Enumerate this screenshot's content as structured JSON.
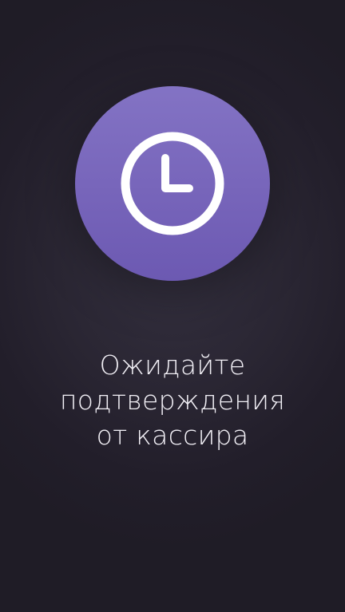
{
  "status": {
    "icon": "clock-icon",
    "accent_color": "#7866bb"
  },
  "message": {
    "line1": "Ожидайте",
    "line2": "подтверждения",
    "line3": "от кассира"
  },
  "colors": {
    "background": "#27232f",
    "text": "#f2f0f6"
  }
}
